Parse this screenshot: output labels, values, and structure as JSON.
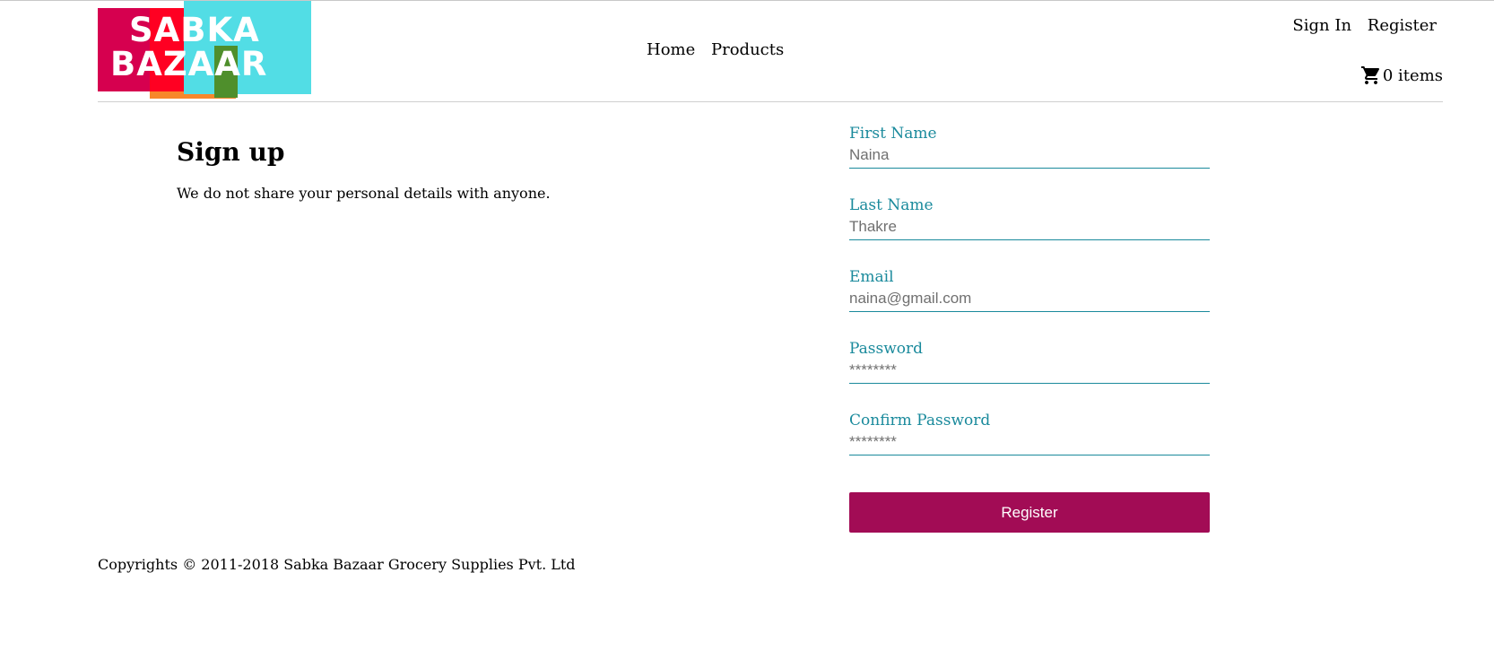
{
  "brand": {
    "logo_line1": "SABKA",
    "logo_line2": "BAZAAR"
  },
  "nav": {
    "home": "Home",
    "products": "Products"
  },
  "account": {
    "sign_in": "Sign In",
    "register": "Register"
  },
  "cart": {
    "icon": "shopping-cart-icon",
    "label": "0 items"
  },
  "intro": {
    "title": "Sign up",
    "subtitle": "We do not share your personal details with anyone."
  },
  "form": {
    "first_name": {
      "label": "First Name",
      "value": "Naina"
    },
    "last_name": {
      "label": "Last Name",
      "value": "Thakre"
    },
    "email": {
      "label": "Email",
      "value": "naina@gmail.com"
    },
    "password": {
      "label": "Password",
      "value": "********"
    },
    "confirm_password": {
      "label": "Confirm Password",
      "value": "********"
    },
    "submit": "Register"
  },
  "footer": {
    "copyright": "Copyrights © 2011-2018 Sabka Bazaar Grocery Supplies Pvt. Ltd"
  },
  "colors": {
    "accent": "#1a8a9c",
    "button": "#a20c55",
    "logo_pink": "#d6004f",
    "logo_cyan": "#52dde5",
    "logo_orange": "#f7872a",
    "logo_green": "#4f8f2c"
  }
}
